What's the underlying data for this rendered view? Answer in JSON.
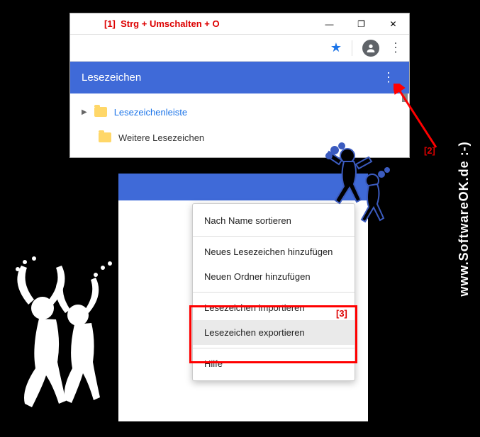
{
  "watermark": "www.SoftwareOK.de :-)",
  "annotation1": {
    "num": "[1]",
    "text": "Strg + Umschalten + O"
  },
  "annotation2": "[2]",
  "annotation3": "[3]",
  "winbtns": {
    "min": "—",
    "max": "❐",
    "close": "✕"
  },
  "bookmarks": {
    "header": "Lesezeichen",
    "rows": [
      {
        "label": "Lesezeichenleiste",
        "link": true
      },
      {
        "label": "Weitere Lesezeichen",
        "link": false
      }
    ]
  },
  "context_menu": {
    "sort": "Nach Name sortieren",
    "new_bm": "Neues Lesezeichen hinzufügen",
    "new_folder": "Neuen Ordner hinzufügen",
    "import": "Lesezeichen importieren",
    "export": "Lesezeichen exportieren",
    "help": "Hilfe"
  }
}
